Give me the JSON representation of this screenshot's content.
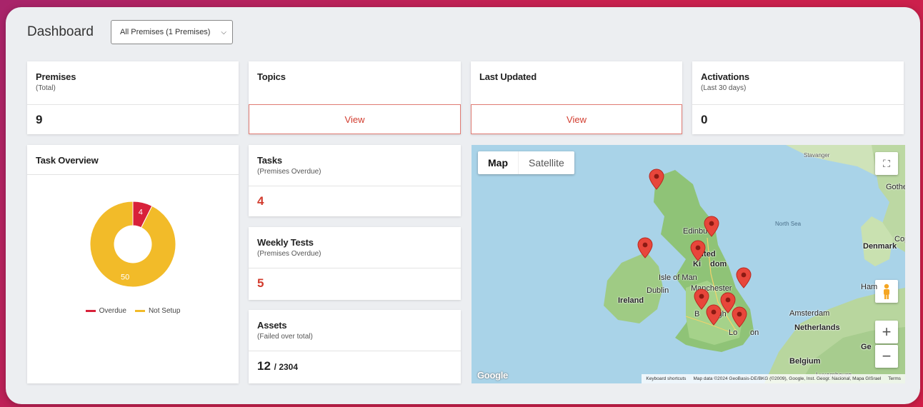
{
  "header": {
    "title": "Dashboard",
    "premises_select": "All Premises (1 Premises)"
  },
  "stats": {
    "premises": {
      "label": "Premises",
      "sub": "(Total)",
      "value": "9"
    },
    "topics": {
      "label": "Topics",
      "button": "View"
    },
    "last_updated": {
      "label": "Last Updated",
      "button": "View"
    },
    "activations": {
      "label": "Activations",
      "sub": "(Last 30 days)",
      "value": "0"
    }
  },
  "task_overview": {
    "title": "Task Overview",
    "chart_data": {
      "type": "pie",
      "categories": [
        "Overdue",
        "Not Setup"
      ],
      "values": [
        4,
        50
      ],
      "colors": [
        "#d8213a",
        "#f2bb29"
      ],
      "legend": "bottom"
    }
  },
  "tasks": {
    "label": "Tasks",
    "sub": "(Premises Overdue)",
    "value": "4"
  },
  "weekly_tests": {
    "label": "Weekly Tests",
    "sub": "(Premises Overdue)",
    "value": "5"
  },
  "assets": {
    "label": "Assets",
    "sub": "(Failed over total)",
    "value": "12",
    "total": "/ 2304"
  },
  "map": {
    "tab_map": "Map",
    "tab_satellite": "Satellite",
    "labels": {
      "stavanger": "Stavanger",
      "gothe": "Gothe",
      "north_sea": "North Sea",
      "cop": "Cop",
      "denmark": "Denmark",
      "edinburgh": "Edinbu",
      "united_kingdom_1": "ited",
      "united_kingdom_2": "Ki",
      "united_kingdom_3": "dom",
      "isle_of_man": "Isle of Man",
      "dublin": "Dublin",
      "ireland": "Ireland",
      "manchester": "Manchester",
      "birmingham_1": "B",
      "birmingham_2": "ingh",
      "birmingham_3": "m",
      "london_1": "Lo",
      "london_2": "on",
      "amsterdam": "Amsterdam",
      "netherlands": "Netherlands",
      "belgium": "Belgium",
      "ham": "Ham",
      "ge": "Ge",
      "luxembourg": "Luxembourg"
    },
    "attribution": {
      "shortcuts": "Keyboard shortcuts",
      "data": "Map data ©2024 GeoBasis-DE/BKG (©2009), Google, Inst. Geogr. Nacional, Mapa GISrael",
      "terms": "Terms"
    },
    "logo": "Google"
  }
}
